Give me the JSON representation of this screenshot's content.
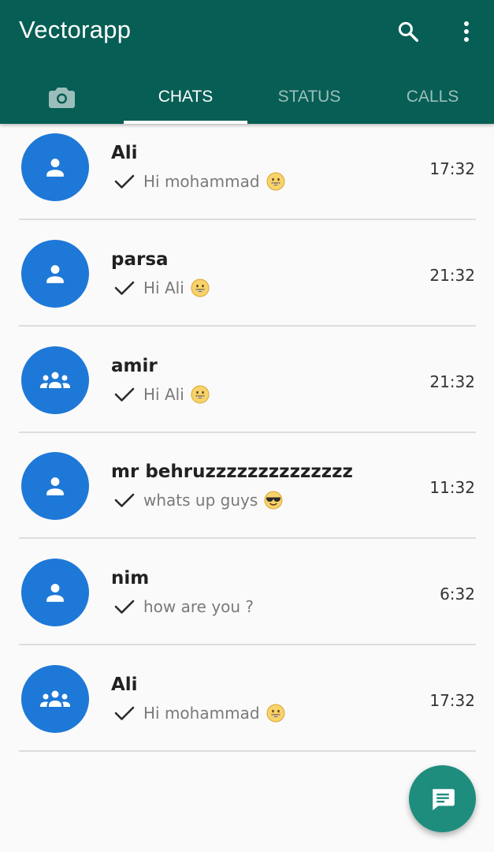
{
  "app": {
    "title": "Vectorapp",
    "colors": {
      "toolbar": "#075e54",
      "avatar": "#1e78d7",
      "fab": "#1e8d7e"
    }
  },
  "actions": {
    "search_icon": "search-icon",
    "more_icon": "more-vert-icon"
  },
  "tabs": [
    {
      "icon": "camera-icon",
      "label": ""
    },
    {
      "label": "CHATS",
      "active": true
    },
    {
      "label": "STATUS"
    },
    {
      "label": "CALLS"
    }
  ],
  "chats": [
    {
      "name": "Ali",
      "message": "Hi mohammad",
      "emoji": "grinning-face-emoji",
      "time": "17:32",
      "avatar": "person-icon"
    },
    {
      "name": "parsa",
      "message": "Hi Ali",
      "emoji": "grinning-face-emoji",
      "time": "21:32",
      "avatar": "person-icon"
    },
    {
      "name": "amir",
      "message": "Hi Ali",
      "emoji": "grinning-face-emoji",
      "time": "21:32",
      "avatar": "group-icon"
    },
    {
      "name": "mr behruzzzzzzzzzzzzzz",
      "message": "whats up guys",
      "emoji": "sunglasses-face-emoji",
      "time": "11:32",
      "avatar": "person-icon"
    },
    {
      "name": "nim",
      "message": "how are you ?",
      "emoji": "",
      "time": "6:32",
      "avatar": "person-icon"
    },
    {
      "name": "Ali",
      "message": "Hi mohammad",
      "emoji": "grinning-face-emoji",
      "time": "17:32",
      "avatar": "group-icon"
    }
  ],
  "fab": {
    "icon": "new-chat-icon"
  }
}
